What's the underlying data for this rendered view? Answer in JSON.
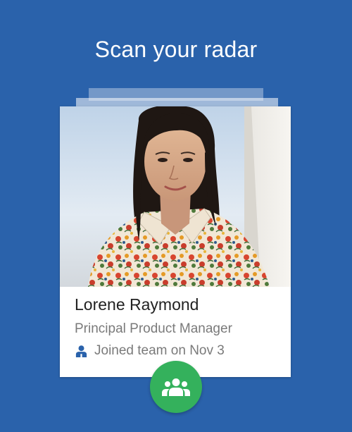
{
  "header": {
    "title": "Scan your radar"
  },
  "profile_card": {
    "name": "Lorene Raymond",
    "role": "Principal Product Manager",
    "joined_text": "Joined team on Nov 3",
    "joined_icon": "person-icon",
    "photo": "profile-photo"
  },
  "action_button": {
    "icon": "group-icon",
    "color": "#34b15c"
  },
  "colors": {
    "background": "#2a62ab",
    "accent_icon": "#2a62ab"
  }
}
